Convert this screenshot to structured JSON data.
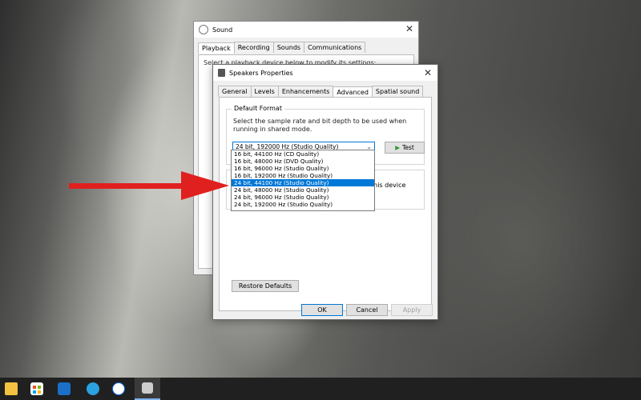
{
  "taskbar": {
    "icons": [
      "file-explorer-icon",
      "microsoft-store-icon",
      "mail-icon",
      "telegram-icon",
      "zalo-icon",
      "sound-settings-icon"
    ]
  },
  "sound_window": {
    "title": "Sound",
    "tabs": [
      "Playback",
      "Recording",
      "Sounds",
      "Communications"
    ],
    "hint": "Select a playback device below to modify its settings:"
  },
  "dialog": {
    "title": "Speakers Properties",
    "tabs": [
      "General",
      "Levels",
      "Enhancements",
      "Advanced",
      "Spatial sound"
    ],
    "active_tab": "Advanced",
    "default_format": {
      "legend": "Default Format",
      "description": "Select the sample rate and bit depth to be used when running in shared mode.",
      "selected": "24 bit, 192000 Hz (Studio Quality)",
      "test_label": "Test"
    },
    "exclusive_text": "this device",
    "restore_label": "Restore Defaults",
    "ok_label": "OK",
    "cancel_label": "Cancel",
    "apply_label": "Apply"
  },
  "dropdown": {
    "options": [
      "16 bit, 44100 Hz (CD Quality)",
      "16 bit, 48000 Hz (DVD Quality)",
      "16 bit, 96000 Hz (Studio Quality)",
      "16 bit, 192000 Hz (Studio Quality)",
      "24 bit, 44100 Hz (Studio Quality)",
      "24 bit, 48000 Hz (Studio Quality)",
      "24 bit, 96000 Hz (Studio Quality)",
      "24 bit, 192000 Hz (Studio Quality)"
    ],
    "highlighted_index": 4
  },
  "colors": {
    "accent": "#0078d7",
    "annotation_arrow": "#e0201e"
  }
}
